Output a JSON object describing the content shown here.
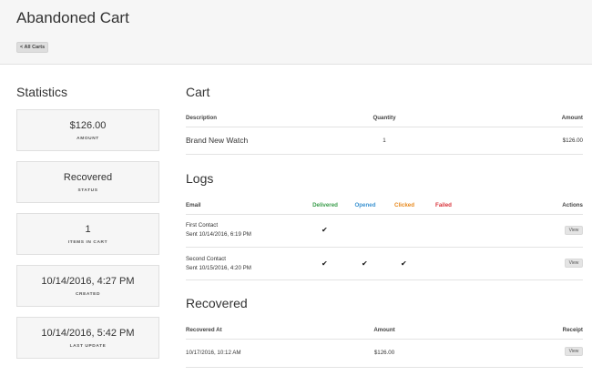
{
  "header": {
    "title": "Abandoned Cart",
    "back_label": "< All Carts"
  },
  "statistics": {
    "title": "Statistics",
    "cards": [
      {
        "value": "$126.00",
        "label": "AMOUNT"
      },
      {
        "value": "Recovered",
        "label": "STATUS"
      },
      {
        "value": "1",
        "label": "ITEMS IN CART"
      },
      {
        "value": "10/14/2016, 4:27 PM",
        "label": "CREATED"
      },
      {
        "value": "10/14/2016, 5:42 PM",
        "label": "LAST UPDATE"
      }
    ]
  },
  "cart": {
    "title": "Cart",
    "headers": {
      "description": "Description",
      "quantity": "Quantity",
      "amount": "Amount"
    },
    "rows": [
      {
        "description": "Brand New Watch",
        "quantity": "1",
        "amount": "$126.00"
      }
    ]
  },
  "logs": {
    "title": "Logs",
    "headers": {
      "email": "Email",
      "delivered": "Delivered",
      "opened": "Opened",
      "clicked": "Clicked",
      "failed": "Failed",
      "actions": "Actions"
    },
    "colors": {
      "delivered": "#3a9d4b",
      "opened": "#3c93d1",
      "clicked": "#e8891d",
      "failed": "#d9323a"
    },
    "check_glyph": "✔",
    "rows": [
      {
        "name": "First Contact",
        "sent": "Sent 10/14/2016, 6:19 PM",
        "action": "View"
      },
      {
        "name": "Second Contact",
        "sent": "Sent 10/15/2016, 4:20 PM",
        "action": "View"
      }
    ]
  },
  "recovered": {
    "title": "Recovered",
    "headers": {
      "recovered_at": "Recovered At",
      "amount": "Amount",
      "receipt": "Receipt"
    },
    "rows": [
      {
        "recovered_at": "10/17/2016, 10:12 AM",
        "amount": "$126.00",
        "action": "View"
      }
    ]
  }
}
